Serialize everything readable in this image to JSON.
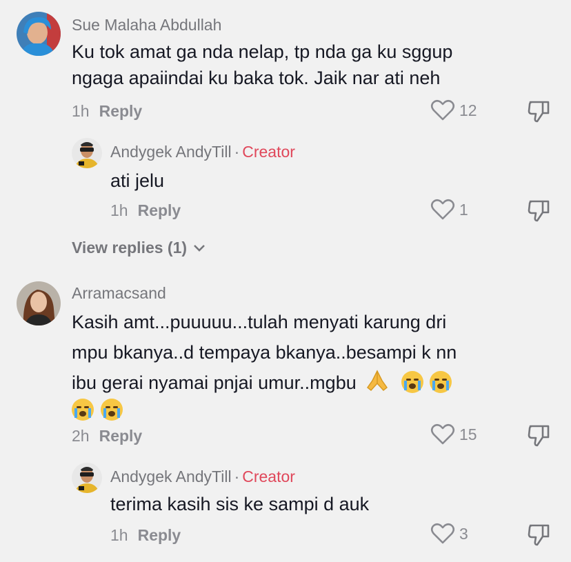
{
  "comments": [
    {
      "username": "Sue Malaha Abdullah",
      "lines": [
        "Ku tok amat ga nda nelap, tp nda ga ku sggup",
        "ngaga apaiindai ku baka tok. Jaik nar ati neh"
      ],
      "time": "1h",
      "reply_label": "Reply",
      "likes": "12",
      "replies": [
        {
          "username": "Andygek AndyTill",
          "separator": "·",
          "badge": "Creator",
          "text": "ati jelu",
          "time": "1h",
          "reply_label": "Reply",
          "likes": "1"
        }
      ],
      "view_replies": "View replies (1)"
    },
    {
      "username": "Arramacsand",
      "lines": [
        "Kasih amt...puuuuu...tulah menyati karung dri",
        "mpu bkanya..d tempaya bkanya..besampi k nn",
        "ibu gerai nyamai pnjai umur..mgbu"
      ],
      "emoji_line3": [
        "folded-hands-emoji",
        "crying-face-emoji",
        "crying-face-emoji"
      ],
      "emoji_line4": [
        "crying-face-emoji",
        "crying-face-emoji"
      ],
      "time": "2h",
      "reply_label": "Reply",
      "likes": "15",
      "replies": [
        {
          "username": "Andygek AndyTill",
          "separator": "·",
          "badge": "Creator",
          "text": "terima kasih sis ke sampi d auk",
          "time": "1h",
          "reply_label": "Reply",
          "likes": "3"
        }
      ]
    }
  ],
  "colors": {
    "background": "#f1f1f1",
    "creator_badge": "#e0475a",
    "muted": "#8a8b91"
  }
}
